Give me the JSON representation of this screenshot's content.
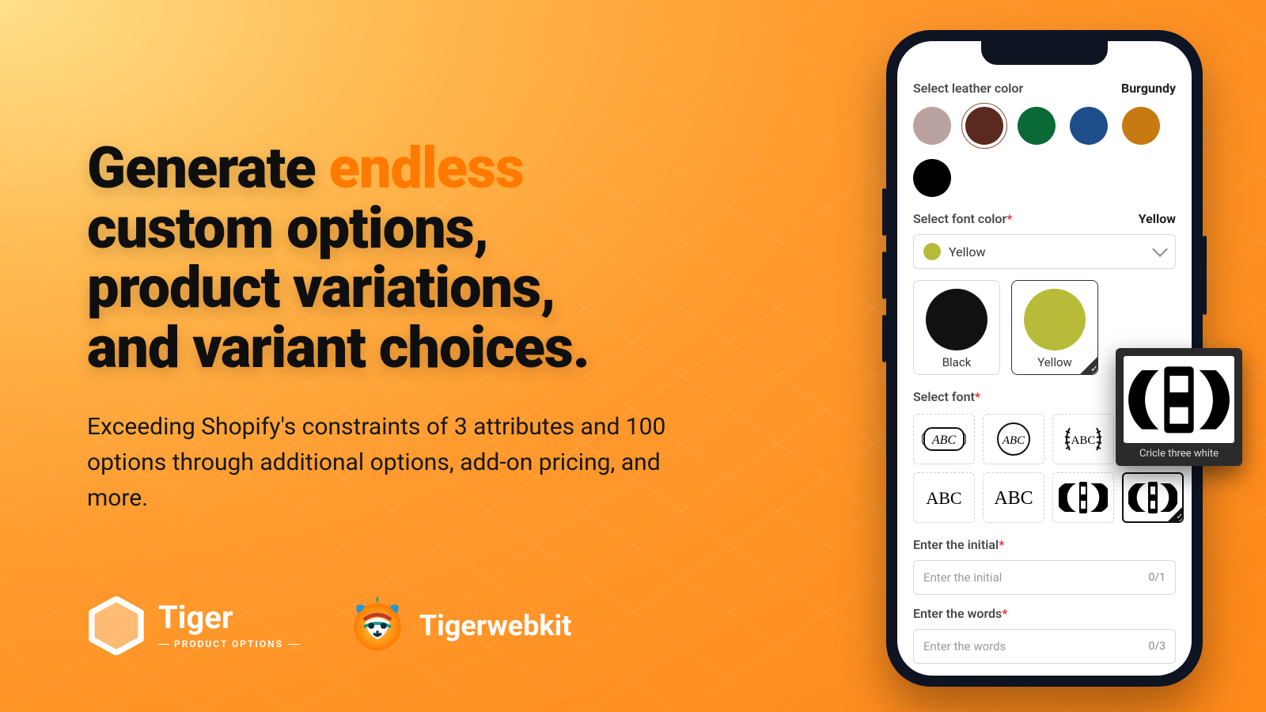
{
  "headline": {
    "l1a": "Generate ",
    "l1b": "endless",
    "l2": "custom options,",
    "l3": "product variations,",
    "l4": "and variant choices."
  },
  "sub": "Exceeding Shopify's constraints of 3 attributes and 100 options through additional options, add-on pricing, and more.",
  "logos": {
    "tiger_brand": "Tiger",
    "tiger_tag": "PRODUCT OPTIONS",
    "twk_brand": "Tigerwebkit"
  },
  "phone": {
    "leather": {
      "label": "Select leather color",
      "value": "Burgundy",
      "colors": [
        "#b9a2a0",
        "#5a2a1f",
        "#0a6a36",
        "#1d4e89",
        "#c77a12",
        "#000000"
      ],
      "selected_index": 1
    },
    "fontcolor": {
      "label": "Select font color",
      "value": "Yellow",
      "select_label": "Yellow",
      "select_hex": "#b8bb3a",
      "tiles": [
        {
          "name": "Black",
          "hex": "#111111"
        },
        {
          "name": "Yellow",
          "hex": "#b8bb3a"
        }
      ],
      "selected_index": 1
    },
    "font": {
      "label": "Select font",
      "options": [
        "frame-abc",
        "circle-abc",
        "laurel-abc",
        "square-abc",
        "plain-abc",
        "script-abc",
        "split-ab",
        "circle-abc-bold"
      ],
      "selected_index": 7
    },
    "initial": {
      "label": "Enter the initial",
      "placeholder": "Enter the initial",
      "count": "0/1"
    },
    "words": {
      "label": "Enter the words",
      "placeholder": "Enter the words",
      "count": "0/3"
    }
  },
  "popover": {
    "caption": "Cricle three white"
  }
}
